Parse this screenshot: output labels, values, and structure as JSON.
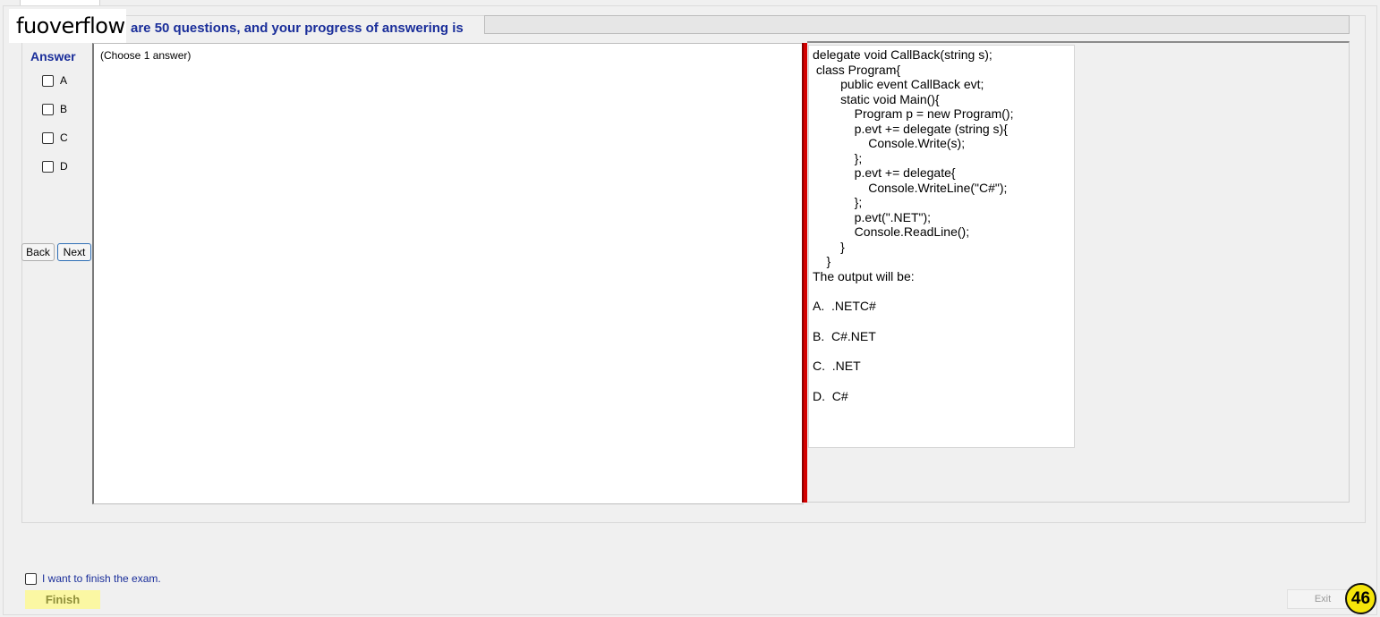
{
  "watermark": "fuoverflow",
  "header": {
    "progress_text": "are 50 questions, and your progress of answering is",
    "progress_value": 0
  },
  "answer_panel": {
    "title": "Answer",
    "options": [
      "A",
      "B",
      "C",
      "D"
    ],
    "back_label": "Back",
    "next_label": "Next"
  },
  "question": {
    "instruction": "(Choose 1 answer)"
  },
  "content": {
    "code_lines": [
      "delegate void CallBack(string s);",
      " class Program{",
      "        public event CallBack evt;",
      "        static void Main(){",
      "            Program p = new Program();",
      "            p.evt += delegate (string s){",
      "                Console.Write(s);",
      "            };",
      "            p.evt += delegate{",
      "                Console.WriteLine(\"C#\");",
      "            };",
      "            p.evt(\".NET\");",
      "            Console.ReadLine();",
      "        }",
      "    }"
    ],
    "prompt": "The output will be:",
    "choices": [
      "A.  .NETC#",
      "B.  C#.NET",
      "C.  .NET",
      "D.  C#"
    ]
  },
  "footer": {
    "finish_check_label": "I want to finish the exam.",
    "finish_label": "Finish",
    "exit_label": "Exit",
    "badge": "46"
  }
}
